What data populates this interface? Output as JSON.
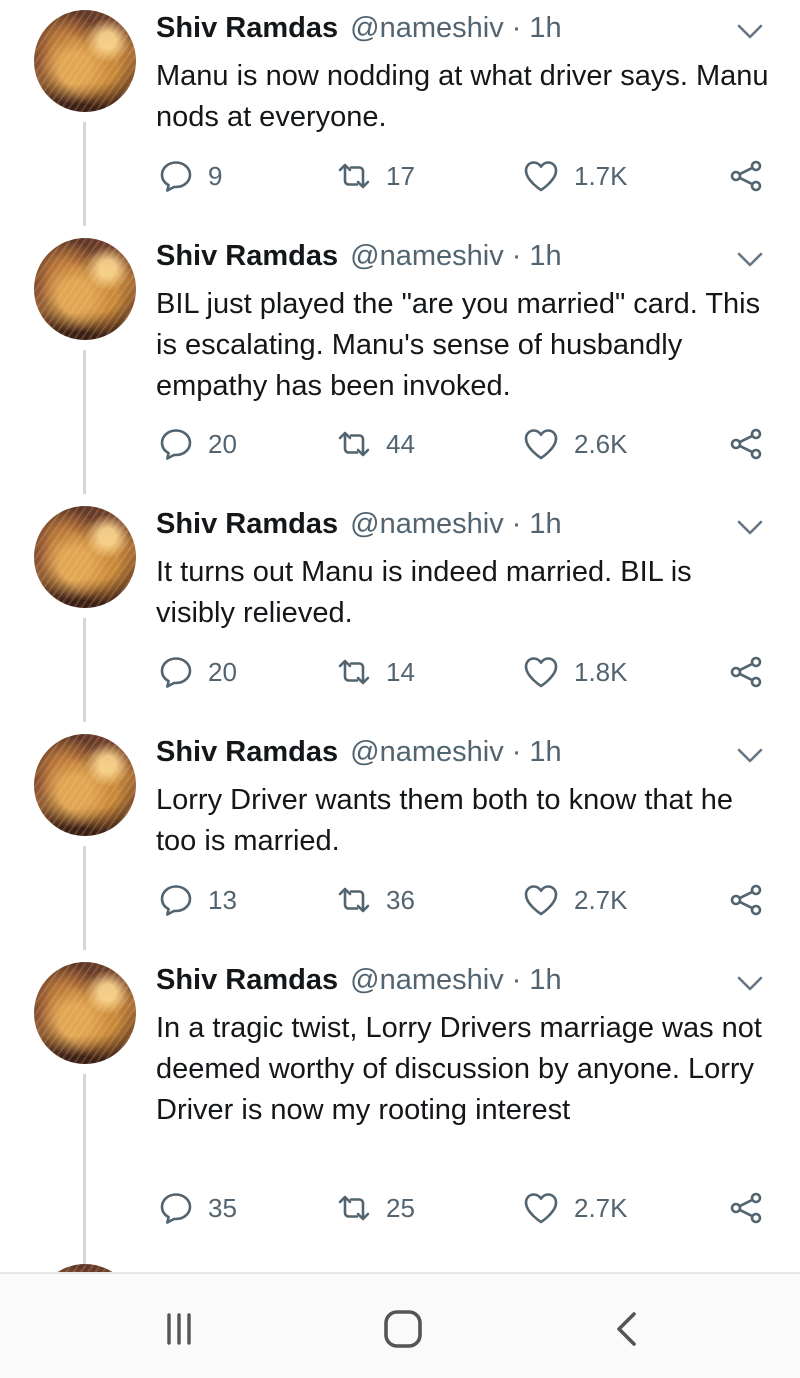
{
  "tweets": [
    {
      "name": "Shiv Ramdas",
      "handle": "@nameshiv",
      "separator": "·",
      "time": "1h",
      "text": "Manu is now nodding at what driver says. Manu nods at everyone.",
      "replies": "9",
      "retweets": "17",
      "likes": "1.7K"
    },
    {
      "name": "Shiv Ramdas",
      "handle": "@nameshiv",
      "separator": "·",
      "time": "1h",
      "text": "BIL just played the \"are you married\" card. This is escalating. Manu's sense of husbandly empathy has been invoked.",
      "replies": "20",
      "retweets": "44",
      "likes": "2.6K"
    },
    {
      "name": "Shiv Ramdas",
      "handle": "@nameshiv",
      "separator": "·",
      "time": "1h",
      "text": "It turns out Manu is indeed married. BIL is visibly relieved.",
      "replies": "20",
      "retweets": "14",
      "likes": "1.8K"
    },
    {
      "name": "Shiv Ramdas",
      "handle": "@nameshiv",
      "separator": "·",
      "time": "1h",
      "text": "Lorry Driver wants them both to know that he too is married.",
      "replies": "13",
      "retweets": "36",
      "likes": "2.7K"
    },
    {
      "name": "Shiv Ramdas",
      "handle": "@nameshiv",
      "separator": "·",
      "time": "1h",
      "text": "In a tragic twist, Lorry Drivers marriage was not deemed worthy of discussion by anyone. Lorry Driver is now my rooting interest",
      "replies": "35",
      "retweets": "25",
      "likes": "2.7K"
    }
  ],
  "icons": {
    "reply": "reply-icon",
    "retweet": "retweet-icon",
    "like": "heart-icon",
    "share": "share-icon",
    "more": "chevron-down-icon",
    "nav_recent": "recent-apps-icon",
    "nav_home": "home-icon",
    "nav_back": "back-icon"
  },
  "colors": {
    "text": "#14171a",
    "secondary": "#536471",
    "thread_line": "#cfd9de",
    "navbar": "#fafafa"
  }
}
